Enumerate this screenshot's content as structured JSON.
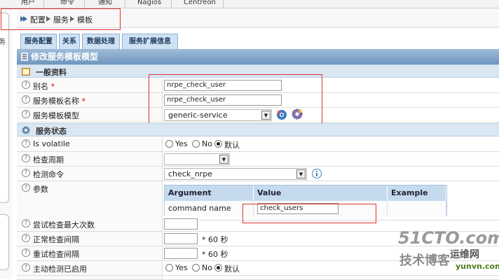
{
  "topnav": {
    "items": [
      "用户",
      "命令",
      "通知",
      "Nagios",
      "Centreon"
    ]
  },
  "left_partial": "务",
  "breadcrumb": [
    "配置",
    "服务",
    "模板"
  ],
  "tabs": [
    "服务配置",
    "关系",
    "数据处理",
    "服务扩展信息"
  ],
  "form_title": "修改服务模板模型",
  "sections": {
    "general": "一般资料",
    "status": "服务状态"
  },
  "fields": {
    "alias": {
      "label": "别名",
      "required": "*",
      "value": "nrpe_check_user"
    },
    "template_name": {
      "label": "服务模板名称",
      "required": "*",
      "value": "nrpe_check_user"
    },
    "template_model": {
      "label": "服务模板模型",
      "value": "generic-service"
    },
    "is_volatile": {
      "label": "Is volatile",
      "options": [
        "Yes",
        "No",
        "默认"
      ],
      "selected": "默认"
    },
    "check_period": {
      "label": "检查周期",
      "value": ""
    },
    "check_command": {
      "label": "检测命令",
      "value": "check_nrpe"
    },
    "args": {
      "label": "参数",
      "headers": [
        "Argument",
        "Value",
        "Example"
      ],
      "rows": [
        {
          "argument": "command name",
          "value": "check_users",
          "example": ""
        }
      ]
    },
    "max_check_attempts": {
      "label": "尝试检查最大次数",
      "value": ""
    },
    "normal_interval": {
      "label": "正常检查间隔",
      "value": "",
      "unit": "* 60 秒"
    },
    "retry_interval": {
      "label": "重试检查间隔",
      "value": "",
      "unit": "* 60 秒"
    },
    "active_checks": {
      "label": "主动检测已启用",
      "options": [
        "Yes",
        "No",
        "默认"
      ],
      "selected": "默认"
    }
  },
  "watermark": {
    "brand": "51CTO.com",
    "sub": "技术博客",
    "site": "yunvn.com",
    "site_label": "运维网"
  },
  "colors": {
    "header": "#7aa0c6",
    "tab": "#cfe2f3",
    "section": "#d9e7f3",
    "highlight": "#dd3333",
    "watermark": "#9a9a9a"
  },
  "icons": [
    "view-icon",
    "add-icon",
    "info-icon",
    "gear-icon",
    "help-icon"
  ]
}
